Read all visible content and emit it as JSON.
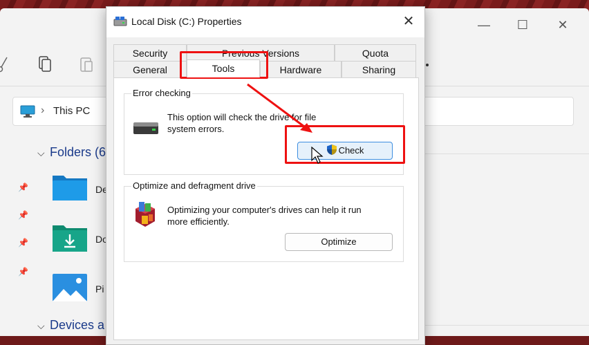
{
  "explorer": {
    "address_sep": "›",
    "address_text": "This PC",
    "groups": [
      {
        "label": "Folders (6"
      },
      {
        "label": "Devices a"
      }
    ],
    "folders": [
      {
        "label": "De"
      },
      {
        "label": "Do"
      },
      {
        "label": "Pi"
      }
    ],
    "pin_glyph": "📌",
    "controls": {
      "minimize": "—",
      "maximize": "☐",
      "close": "✕"
    }
  },
  "dialog": {
    "title": "Local Disk (C:) Properties",
    "close_glyph": "✕",
    "tabs_top": [
      {
        "label": "Security"
      },
      {
        "label": "Previous Versions"
      },
      {
        "label": "Quota"
      }
    ],
    "tabs_bottom": [
      {
        "label": "General"
      },
      {
        "label": "Tools",
        "active": true
      },
      {
        "label": "Hardware"
      },
      {
        "label": "Sharing"
      }
    ],
    "error_checking": {
      "caption": "Error checking",
      "line1": "This option will check the drive for file",
      "line2": "system errors.",
      "button": "Check"
    },
    "optimize": {
      "caption": "Optimize and defragment drive",
      "line1": "Optimizing your computer's drives can help it run",
      "line2": "more efficiently.",
      "button": "Optimize"
    }
  },
  "colors": {
    "annotation_red": "#ee1111",
    "folder_blue": "#1e9be8",
    "folder_teal": "#17a589",
    "button_hover_border": "#3d8ee0"
  }
}
